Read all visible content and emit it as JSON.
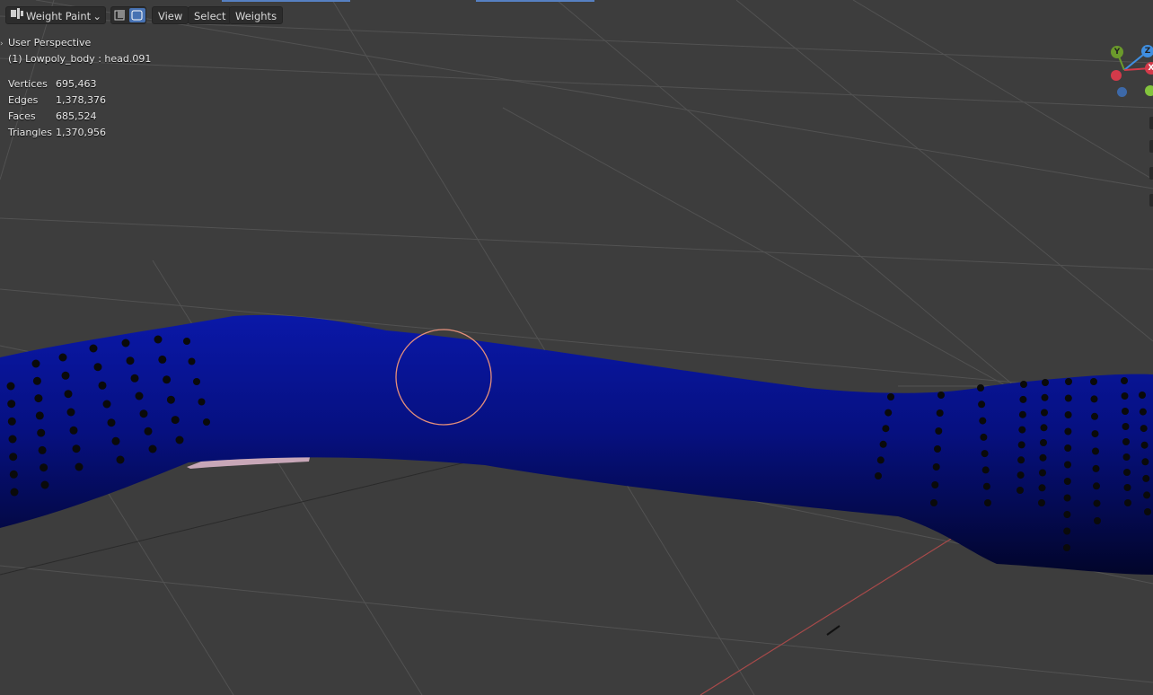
{
  "header": {
    "mode_label": "Weight Paint",
    "mode_icon": "weight-paint-mode-icon",
    "xray_icon": "xray-toggle-icon",
    "menus": [
      "View",
      "Select",
      "Weights"
    ]
  },
  "overlay": {
    "perspective": "User Perspective",
    "object": "(1) Lowpoly_body : head.091",
    "stats": [
      {
        "label": "Vertices",
        "value": "695,463"
      },
      {
        "label": "Edges",
        "value": "1,378,376"
      },
      {
        "label": "Faces",
        "value": "685,524"
      },
      {
        "label": "Triangles",
        "value": "1,370,956"
      }
    ]
  },
  "gizmo": {
    "axes": [
      "Y",
      "Z",
      "X"
    ],
    "colors": {
      "x": "#d43a4a",
      "y": "#6b9a2b",
      "z": "#3f8ee0"
    }
  },
  "colors": {
    "viewport_bg": "#3d3d3d",
    "grid": "#505050",
    "mesh_weight": "#050a7a",
    "brush_circle": "#e58f7a",
    "accent": "#4772b3"
  }
}
